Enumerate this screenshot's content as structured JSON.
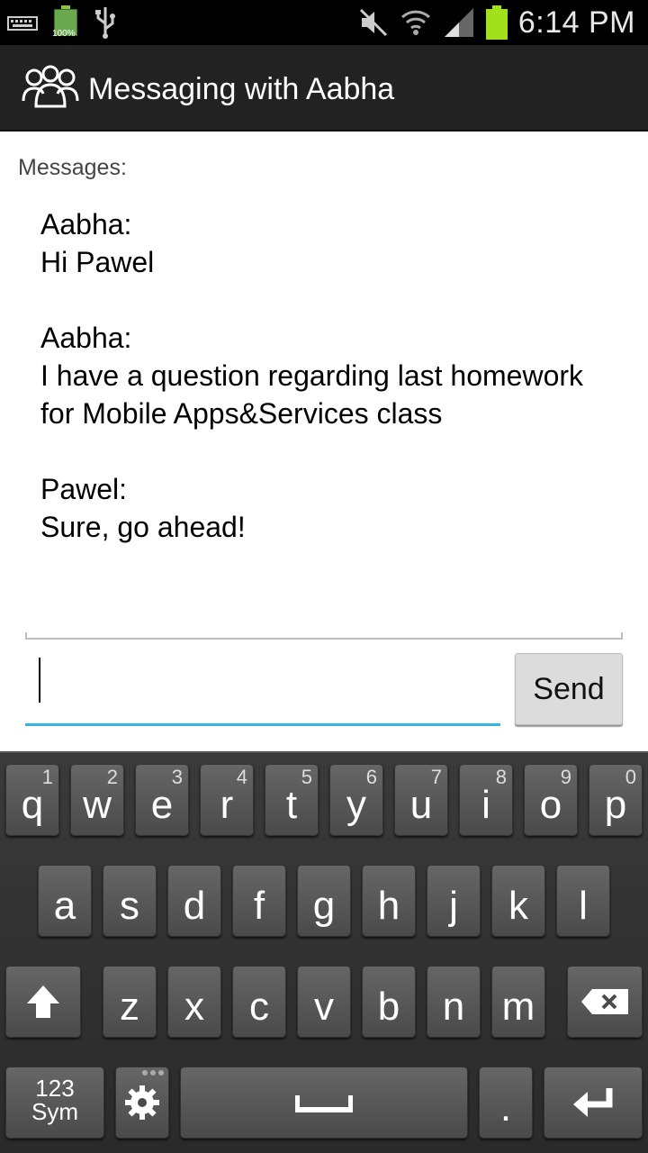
{
  "status_bar": {
    "time": "6:14 PM",
    "battery_small_percent": "100%",
    "icons": [
      "keyboard-icon",
      "battery-icon",
      "usb-icon",
      "mute-icon",
      "wifi-icon",
      "signal-icon",
      "battery-icon"
    ]
  },
  "action_bar": {
    "title": "Messaging with Aabha",
    "icon": "group-icon"
  },
  "content": {
    "messages_label": "Messages:",
    "messages": [
      {
        "sender": "Aabha:",
        "text": "Hi Pawel"
      },
      {
        "sender": "Aabha:",
        "text": "I have a question regarding last homework for Mobile Apps&Services class"
      },
      {
        "sender": "Pawel:",
        "text": "Sure, go ahead!"
      }
    ],
    "input_value": "",
    "send_label": "Send"
  },
  "keyboard": {
    "row1": [
      {
        "key": "q",
        "sub": "1"
      },
      {
        "key": "w",
        "sub": "2"
      },
      {
        "key": "e",
        "sub": "3"
      },
      {
        "key": "r",
        "sub": "4"
      },
      {
        "key": "t",
        "sub": "5"
      },
      {
        "key": "y",
        "sub": "6"
      },
      {
        "key": "u",
        "sub": "7"
      },
      {
        "key": "i",
        "sub": "8"
      },
      {
        "key": "o",
        "sub": "9"
      },
      {
        "key": "p",
        "sub": "0"
      }
    ],
    "row2": [
      "a",
      "s",
      "d",
      "f",
      "g",
      "h",
      "j",
      "k",
      "l"
    ],
    "row3": [
      "z",
      "x",
      "c",
      "v",
      "b",
      "n",
      "m"
    ],
    "sym_top": "123",
    "sym_bottom": "Sym",
    "period": "."
  },
  "colors": {
    "accent": "#33b5e5",
    "action_bar": "#222222",
    "battery": "#a2e01b"
  }
}
